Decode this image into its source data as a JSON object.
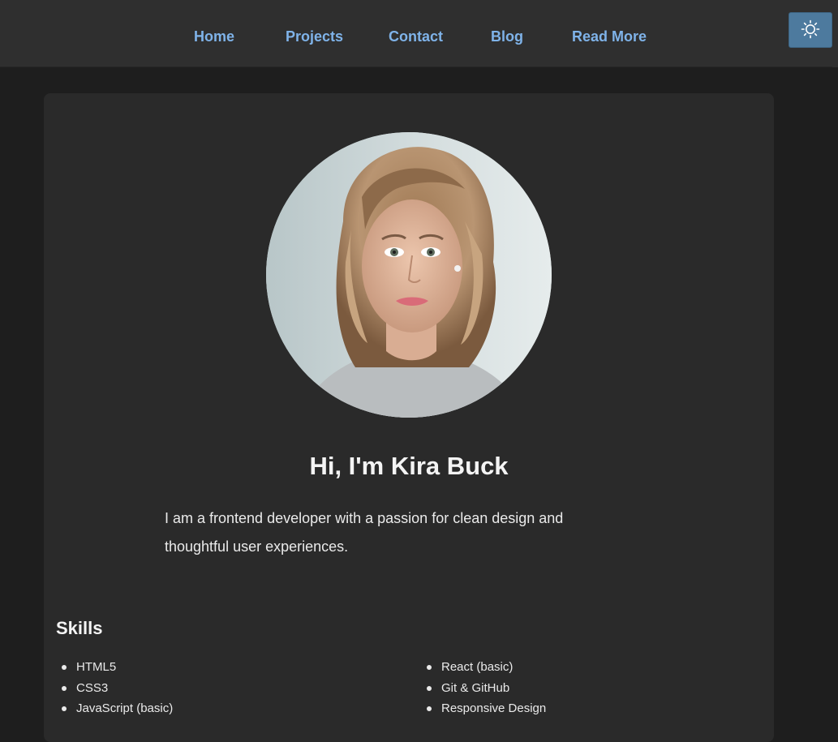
{
  "nav": {
    "items": [
      {
        "label": "Home"
      },
      {
        "label": "Projects"
      },
      {
        "label": "Contact"
      },
      {
        "label": "Blog"
      },
      {
        "label": "Read More"
      }
    ],
    "theme_toggle_icon": "sun-icon"
  },
  "hero": {
    "avatar": "profile-photo",
    "greeting": "Hi, I'm Kira Buck",
    "intro": "I am a frontend developer with a passion for clean design and thoughtful user experiences."
  },
  "skills": {
    "title": "Skills",
    "left": [
      "HTML5",
      "CSS3",
      "JavaScript (basic)"
    ],
    "right": [
      "React (basic)",
      "Git & GitHub",
      "Responsive Design"
    ]
  },
  "colors": {
    "page_bg": "#1e1e1e",
    "navbar_bg": "#2f2f2f",
    "card_bg": "#2a2a2a",
    "link": "#7fb3e9",
    "toggle_bg": "#4d7a9e"
  }
}
